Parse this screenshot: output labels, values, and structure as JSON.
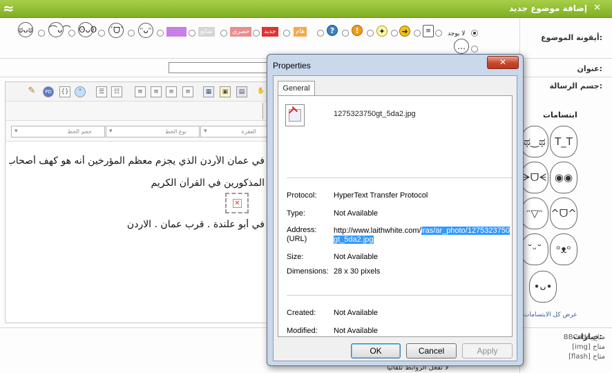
{
  "window": {
    "title": "إضافة موضوع جديد",
    "close": "✕"
  },
  "form": {
    "topic_icon_label": "أيقونة الموضوع:",
    "no_icon_label": "لا يوجد",
    "title_label": "عنوان:",
    "message_label": "جسم الرسالة:",
    "smilies_title": "ابتسامات",
    "show_all_smilies": "عرض كل الابتسامات",
    "options_title": "خيارات:",
    "options": [
      "BBCode متاح",
      "[img] متاح",
      "[flash] متاح"
    ],
    "scroll_check_label": "لا تفعل الروابط تلقائيا"
  },
  "icon_tags": [
    "جديد",
    "حصري",
    "شائع",
    "هام"
  ],
  "editor": {
    "select_size": "حجم الخط",
    "select_font": "نوع الخط",
    "select_para": "الفقرة",
    "lines": [
      "في عمان الأردن الذي يجزم معظم المؤرخين أنه هو كهف أصحاب",
      "المذكورين في القرآن الكريم",
      "في أبو علندة . قرب عمان . الاردن"
    ]
  },
  "dialog": {
    "title": "Properties",
    "close": "✕",
    "tab": "General",
    "file_name": "1275323750gt_5da2.jpg",
    "props": {
      "protocol_label": "Protocol:",
      "protocol": "HyperText Transfer Protocol",
      "type_label": "Type:",
      "type": "Not Available",
      "address_label": "Address:",
      "address_label2": "(URL)",
      "address_plain": "http://www.laithwhite.com/",
      "address_selected": "iras/ar_photo/1275323750gt_5da2.jpg",
      "size_label": "Size:",
      "size": "Not Available",
      "dimensions_label": "Dimensions:",
      "dimensions": "28 x 30 pixels",
      "created_label": "Created:",
      "created": "Not Available",
      "modified_label": "Modified:",
      "modified": "Not Available"
    },
    "buttons": {
      "ok": "OK",
      "cancel": "Cancel",
      "apply": "Apply"
    }
  },
  "colors": {
    "header_green": "#8bbb2e",
    "dialog_frame": "#c9d8ea",
    "selection": "#3399ff"
  }
}
